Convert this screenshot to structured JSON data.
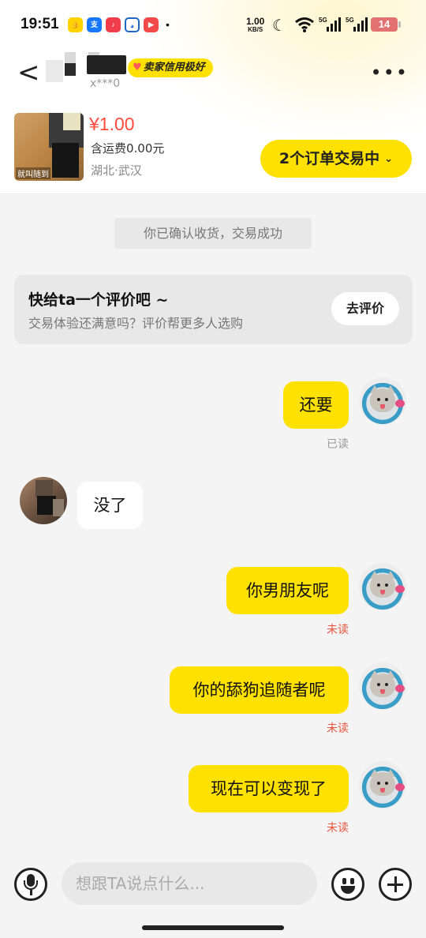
{
  "status_bar": {
    "time": "19:51",
    "notif_icons": [
      "thumbs-up-app",
      "alipay-app",
      "music-app",
      "weibo-app",
      "video-app"
    ],
    "more_dot": "•",
    "net_speed": "1.00",
    "net_unit": "KB/S",
    "sig_label_1": "5G",
    "sig_label_2": "5G",
    "battery": "14"
  },
  "header": {
    "back_label": "<",
    "contact_sub": "x***0",
    "credit_badge": "卖家信用极好",
    "more_label": "•••"
  },
  "product": {
    "image_caption": "就叫随到",
    "price": "¥1.00",
    "shipping": "含运费0.00元",
    "location": "湖北·武汉",
    "orders_button": "2个订单交易中",
    "orders_chevron": "⌄"
  },
  "system_notice": "你已确认收货，交易成功",
  "review_prompt": {
    "title": "快给ta一个评价吧 ~",
    "subtitle": "交易体验还满意吗？评价帮更多人选购",
    "button": "去评价"
  },
  "messages": [
    {
      "from": "me",
      "text": "还要",
      "status": "已读"
    },
    {
      "from": "them",
      "text": "没了"
    },
    {
      "from": "me",
      "text": "你男朋友呢",
      "status": "未读"
    },
    {
      "from": "me",
      "text": "你的舔狗追随者呢",
      "status": "未读"
    },
    {
      "from": "me",
      "text": "现在可以变现了",
      "status": "未读"
    }
  ],
  "input_bar": {
    "placeholder": "想跟TA说点什么..."
  },
  "colors": {
    "accent": "#ffe100",
    "price": "#ff4b3e",
    "unread": "#e8553e"
  }
}
